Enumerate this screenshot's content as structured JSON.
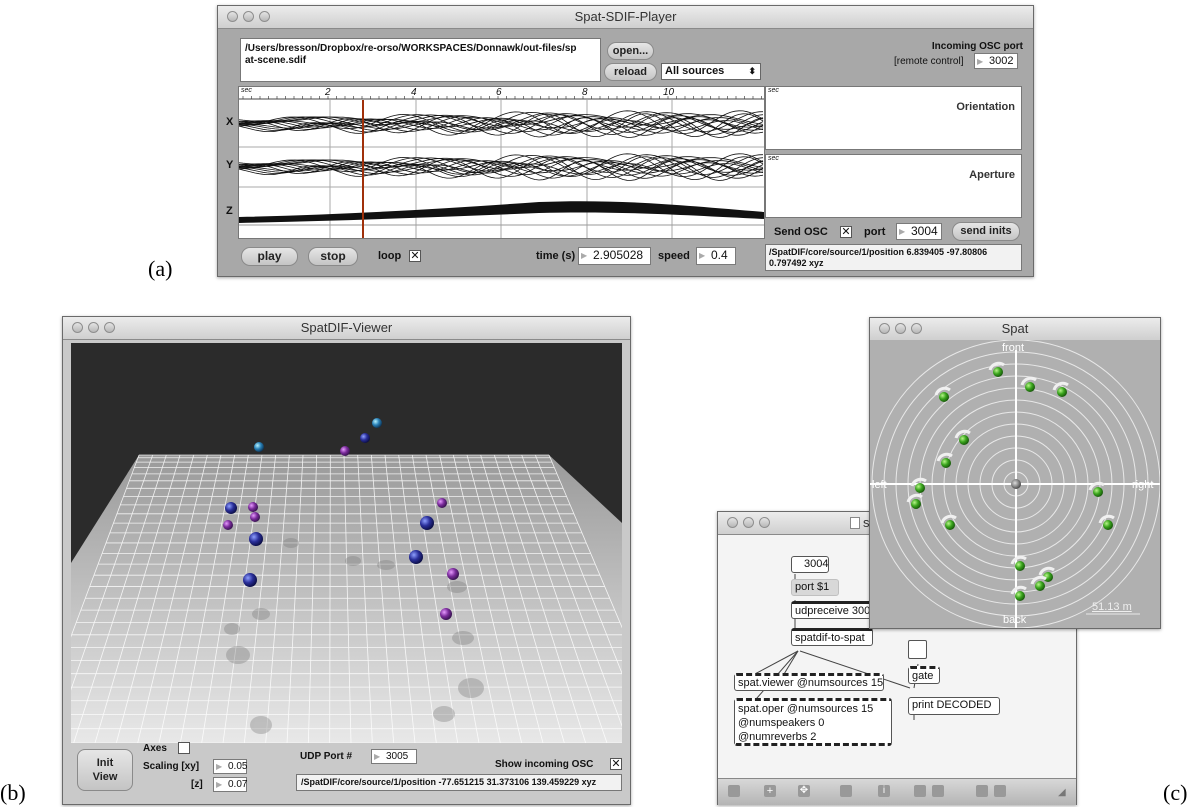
{
  "panel_labels": {
    "a": "(a)",
    "b": "(b)",
    "c": "(c)"
  },
  "player": {
    "title": "Spat-SDIF-Player",
    "file_path_line1": "/Users/bresson/Dropbox/re-orso/WORKSPACES/Donnawk/out-files/sp",
    "file_path_line2": "at-scene.sdif",
    "open_label": "open...",
    "reload_label": "reload",
    "sources_value": "All sources",
    "incoming_label": "Incoming OSC port",
    "remote_label": "[remote control]",
    "remote_port": "3002",
    "timeline_unit": "sec",
    "timeline_ticks": [
      "2",
      "4",
      "6",
      "8",
      "10"
    ],
    "axis_x": "X",
    "axis_y": "Y",
    "axis_z": "Z",
    "orientation_unit": "sec",
    "orientation_label": "Orientation",
    "aperture_unit": "sec",
    "aperture_label": "Aperture",
    "send_osc_label": "Send OSC",
    "send_osc_check": "✕",
    "port_label": "port",
    "port_value": "3004",
    "send_inits_label": "send inits",
    "play_label": "play",
    "stop_label": "stop",
    "loop_label": "loop",
    "loop_check": "✕",
    "time_label": "time (s)",
    "time_value": "2.905028",
    "speed_label": "speed",
    "speed_value": "0.4",
    "osc_msg_line1": "/SpatDIF/core/source/1/position 6.839405 -97.80806",
    "osc_msg_line2": "0.797492 xyz"
  },
  "viewer": {
    "title": "SpatDIF-Viewer",
    "init_view_line1": "Init",
    "init_view_line2": "View",
    "axes_label": "Axes",
    "scaling_xy_label": "Scaling [xy]",
    "scaling_xy_value": "0.05",
    "z_label": "[z]",
    "z_value": "0.07",
    "udp_label": "UDP Port #",
    "udp_value": "3005",
    "show_osc_label": "Show incoming OSC",
    "show_osc_check": "✕",
    "osc_msg": "/SpatDIF/core/source/1/position -77.651215 31.373106 139.459229 xyz"
  },
  "patcher": {
    "partial_title": "s",
    "port_number": "3004",
    "port_msg": "port $1",
    "udpreceive": "udpreceive 300",
    "spatdif_to_spat": "spatdif-to-spat",
    "gate": "gate",
    "spat_viewer": "spat.viewer @numsources 15",
    "print": "print DECODED",
    "spat_oper_line1": "spat.oper @numsources 15",
    "spat_oper_line2": "@numspeakers 0",
    "spat_oper_line3": "@numreverbs 2"
  },
  "spat": {
    "title": "Spat",
    "front": "front",
    "back": "back",
    "left": "left",
    "right": "right",
    "scale": "51.13 m"
  }
}
